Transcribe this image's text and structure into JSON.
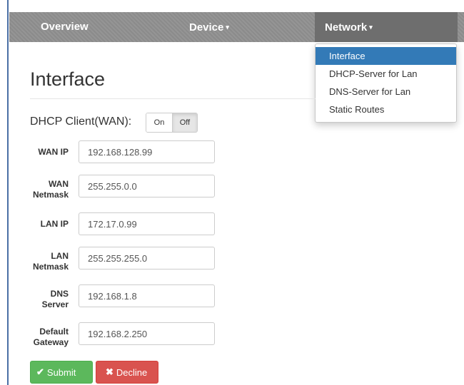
{
  "navbar": {
    "items": [
      {
        "label": "Overview",
        "has_caret": false
      },
      {
        "label": "Device",
        "has_caret": true
      },
      {
        "label": "Network",
        "has_caret": true
      }
    ],
    "caret": "▾"
  },
  "dropdown": {
    "items": [
      {
        "label": "Interface",
        "active": true
      },
      {
        "label": "DHCP-Server for Lan",
        "active": false
      },
      {
        "label": "DNS-Server for Lan",
        "active": false
      },
      {
        "label": "Static Routes",
        "active": false
      }
    ]
  },
  "page": {
    "title": "Interface"
  },
  "dhcp": {
    "label": "DHCP Client(WAN):",
    "on_label": "On",
    "off_label": "Off",
    "selected": "Off"
  },
  "fields": [
    {
      "label_line1": "WAN IP",
      "label_line2": "",
      "value": "192.168.128.99"
    },
    {
      "label_line1": "WAN",
      "label_line2": "Netmask",
      "value": "255.255.0.0"
    },
    {
      "label_line1": "LAN IP",
      "label_line2": "",
      "value": "172.17.0.99"
    },
    {
      "label_line1": "LAN",
      "label_line2": "Netmask",
      "value": "255.255.255.0"
    },
    {
      "label_line1": "DNS",
      "label_line2": "Server",
      "value": "192.168.1.8"
    },
    {
      "label_line1": "Default",
      "label_line2": "Gateway",
      "value": "192.168.2.250"
    }
  ],
  "buttons": {
    "submit_label": "Submit",
    "submit_icon": "check-icon",
    "decline_label": "Decline",
    "decline_icon": "x-icon"
  },
  "colors": {
    "navbar_bg": "#8f8f8f",
    "navbar_active_bg": "#6e6e6e",
    "dropdown_active": "#337ab7",
    "submit_green": "#5cb85c",
    "decline_red": "#d9534f"
  }
}
